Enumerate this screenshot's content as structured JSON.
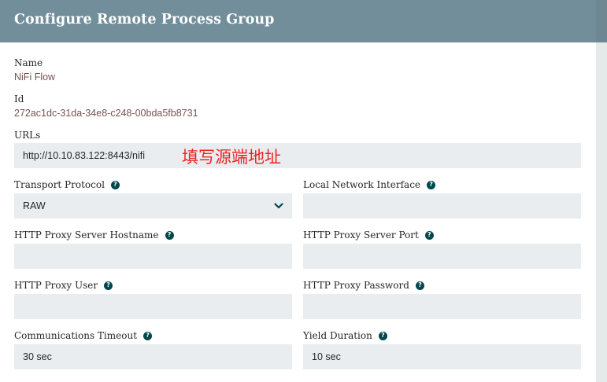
{
  "dialog": {
    "title": "Configure Remote Process Group"
  },
  "name": {
    "label": "Name",
    "value": "NiFi Flow"
  },
  "id": {
    "label": "Id",
    "value": "272ac1dc-31da-34e8-c248-00bda5fb8731"
  },
  "urls": {
    "label": "URLs",
    "value": "http://10.10.83.122:8443/nifi"
  },
  "annotation": "填写源端地址",
  "transport_protocol": {
    "label": "Transport Protocol",
    "value": "RAW"
  },
  "local_network_interface": {
    "label": "Local Network Interface",
    "value": ""
  },
  "proxy_hostname": {
    "label": "HTTP Proxy Server Hostname",
    "value": ""
  },
  "proxy_port": {
    "label": "HTTP Proxy Server Port",
    "value": ""
  },
  "proxy_user": {
    "label": "HTTP Proxy User",
    "value": ""
  },
  "proxy_password": {
    "label": "HTTP Proxy Password",
    "value": ""
  },
  "communications_timeout": {
    "label": "Communications Timeout",
    "value": "30 sec"
  },
  "yield_duration": {
    "label": "Yield Duration",
    "value": "10 sec"
  },
  "icons": {
    "help": "question-circle-icon",
    "dropdown": "chevron-down-icon"
  },
  "colors": {
    "header_bg": "#728e9b",
    "field_bg": "#eaedf0",
    "value_text": "#775351",
    "help_icon": "#004849",
    "annotation": "#ee2222"
  }
}
